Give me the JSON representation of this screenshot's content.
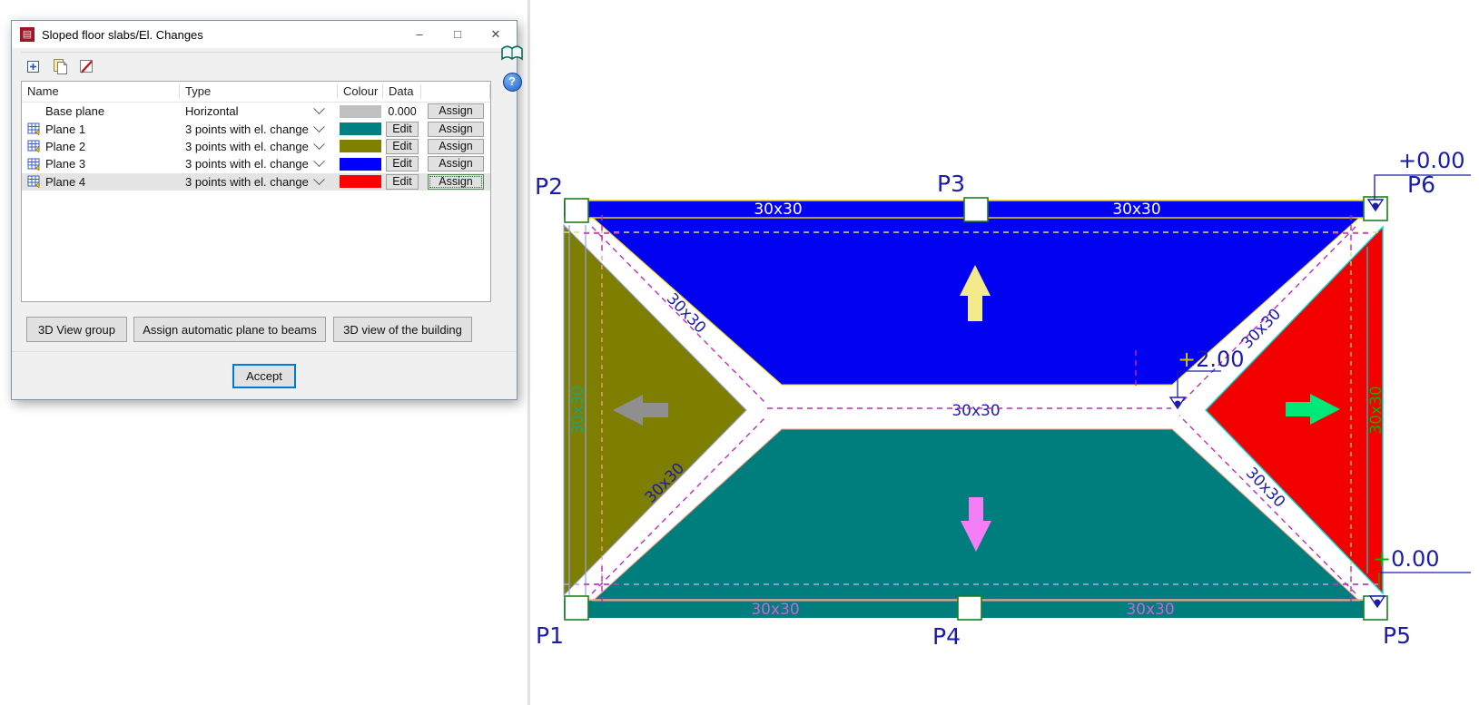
{
  "dialog": {
    "title": "Sloped floor slabs/El. Changes",
    "window_controls": {
      "minimize": "–",
      "maximize": "□",
      "close": "✕"
    },
    "toolbar_icons": [
      "add",
      "copy",
      "edit"
    ],
    "accent": "#0078d7",
    "table": {
      "headers": {
        "name": "Name",
        "type": "Type",
        "colour": "Colour",
        "data": "Data"
      },
      "rows": [
        {
          "name": "Base plane",
          "type": "Horizontal",
          "colour": "#c0c0c0",
          "data_text": "0.000",
          "assign": "Assign",
          "icon": false,
          "selected": false
        },
        {
          "name": "Plane 1",
          "type": "3 points with el. change",
          "colour": "#008080",
          "edit": "Edit",
          "assign": "Assign",
          "icon": true,
          "selected": false
        },
        {
          "name": "Plane 2",
          "type": "3 points with el. change",
          "colour": "#808000",
          "edit": "Edit",
          "assign": "Assign",
          "icon": true,
          "selected": false
        },
        {
          "name": "Plane 3",
          "type": "3 points with el. change",
          "colour": "#0000ff",
          "edit": "Edit",
          "assign": "Assign",
          "icon": true,
          "selected": false
        },
        {
          "name": "Plane 4",
          "type": "3 points with el. change",
          "colour": "#ff0000",
          "edit": "Edit",
          "assign": "Assign",
          "icon": true,
          "selected": true,
          "focused": true
        }
      ]
    },
    "action_buttons": [
      "3D View group",
      "Assign automatic plane to beams",
      "3D view of the building"
    ],
    "accept": "Accept"
  },
  "side_icons": {
    "help": "?"
  },
  "drawing": {
    "beam_label": "30x30",
    "points": {
      "p1": "P1",
      "p2": "P2",
      "p3": "P3",
      "p4": "P4",
      "p5": "P5",
      "p6": "P6"
    },
    "levels": {
      "top_right": "+0.00",
      "middle_plus": "+",
      "middle_value": "2.00",
      "bottom_right_plus": "+",
      "bottom_right_value": "0.00"
    },
    "colors": {
      "plane_blue": "#0202f2",
      "plane_teal": "#007e7e",
      "plane_olive": "#7e7e00",
      "plane_red": "#f30000",
      "beam_edge_yellow": "#e8d400",
      "beam_edge_salmon": "#f2a084",
      "grid_dash_yellow": "#d8e26a",
      "grid_dash_violet": "#b7a0f2",
      "edge_light_blue": "#96a0e8",
      "edge_cyan": "#00d8d8",
      "green_line": "#00b400",
      "axis_magenta": "#bb2dbb",
      "label_magenta": "#d45fd4",
      "label_navy": "#1c1ca8",
      "label_white": "#ffffff",
      "label_teal": "#1da383",
      "label_green": "#00b400",
      "level_plus_yellow": "#d4c400",
      "column_green": "#1e7d1e",
      "arrow_yellow": "#f3eb8a",
      "arrow_pink": "#f57df5",
      "arrow_gray": "#8f8f8f",
      "arrow_green": "#00e878"
    }
  }
}
